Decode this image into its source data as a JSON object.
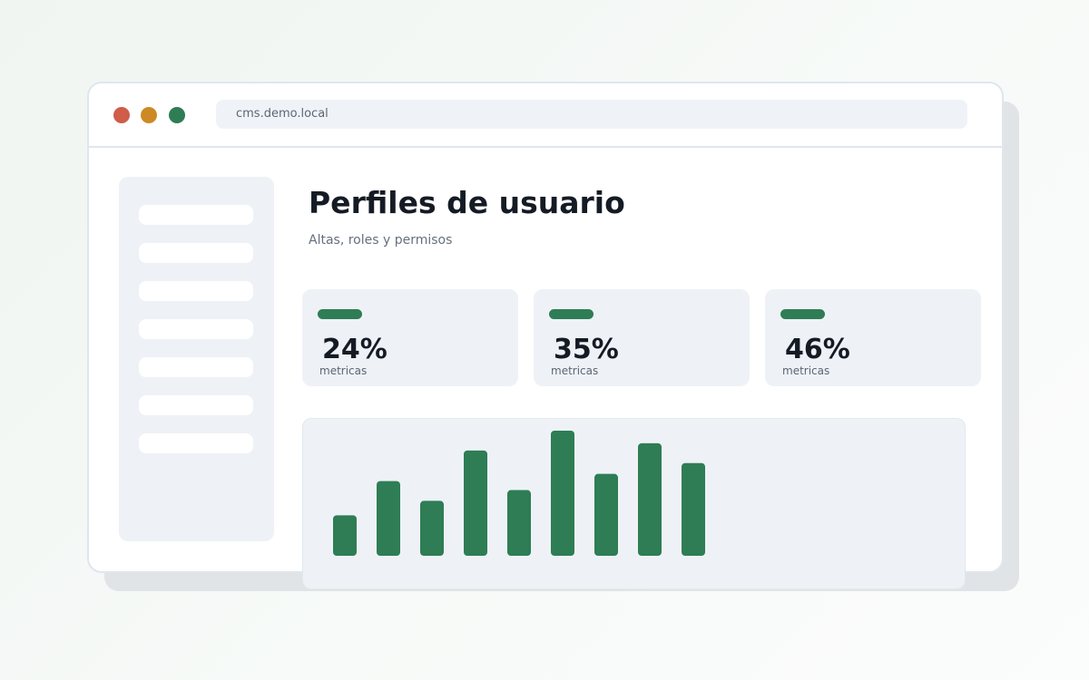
{
  "browser": {
    "url": "cms.demo.local",
    "controls": [
      {
        "name": "close",
        "color": "#d05c4a"
      },
      {
        "name": "minimize",
        "color": "#cd8a24"
      },
      {
        "name": "maximize",
        "color": "#2e7d55"
      }
    ]
  },
  "sidebar": {
    "item_count": 7,
    "active_index": 1
  },
  "main": {
    "title": "Perfiles de usuario",
    "subtitle": "Altas, roles y permisos",
    "stats": [
      {
        "value": "24%",
        "label": "metricas"
      },
      {
        "value": "35%",
        "label": "metricas"
      },
      {
        "value": "46%",
        "label": "metricas"
      }
    ]
  },
  "colors": {
    "accent": "#2e7d55",
    "panel": "#eef2f6",
    "text": "#151b24"
  },
  "chart_data": {
    "type": "bar",
    "values": [
      45,
      83,
      61,
      117,
      73,
      139,
      91,
      125,
      103
    ],
    "ylim": [
      0,
      140
    ],
    "color": "#2e7d55"
  }
}
